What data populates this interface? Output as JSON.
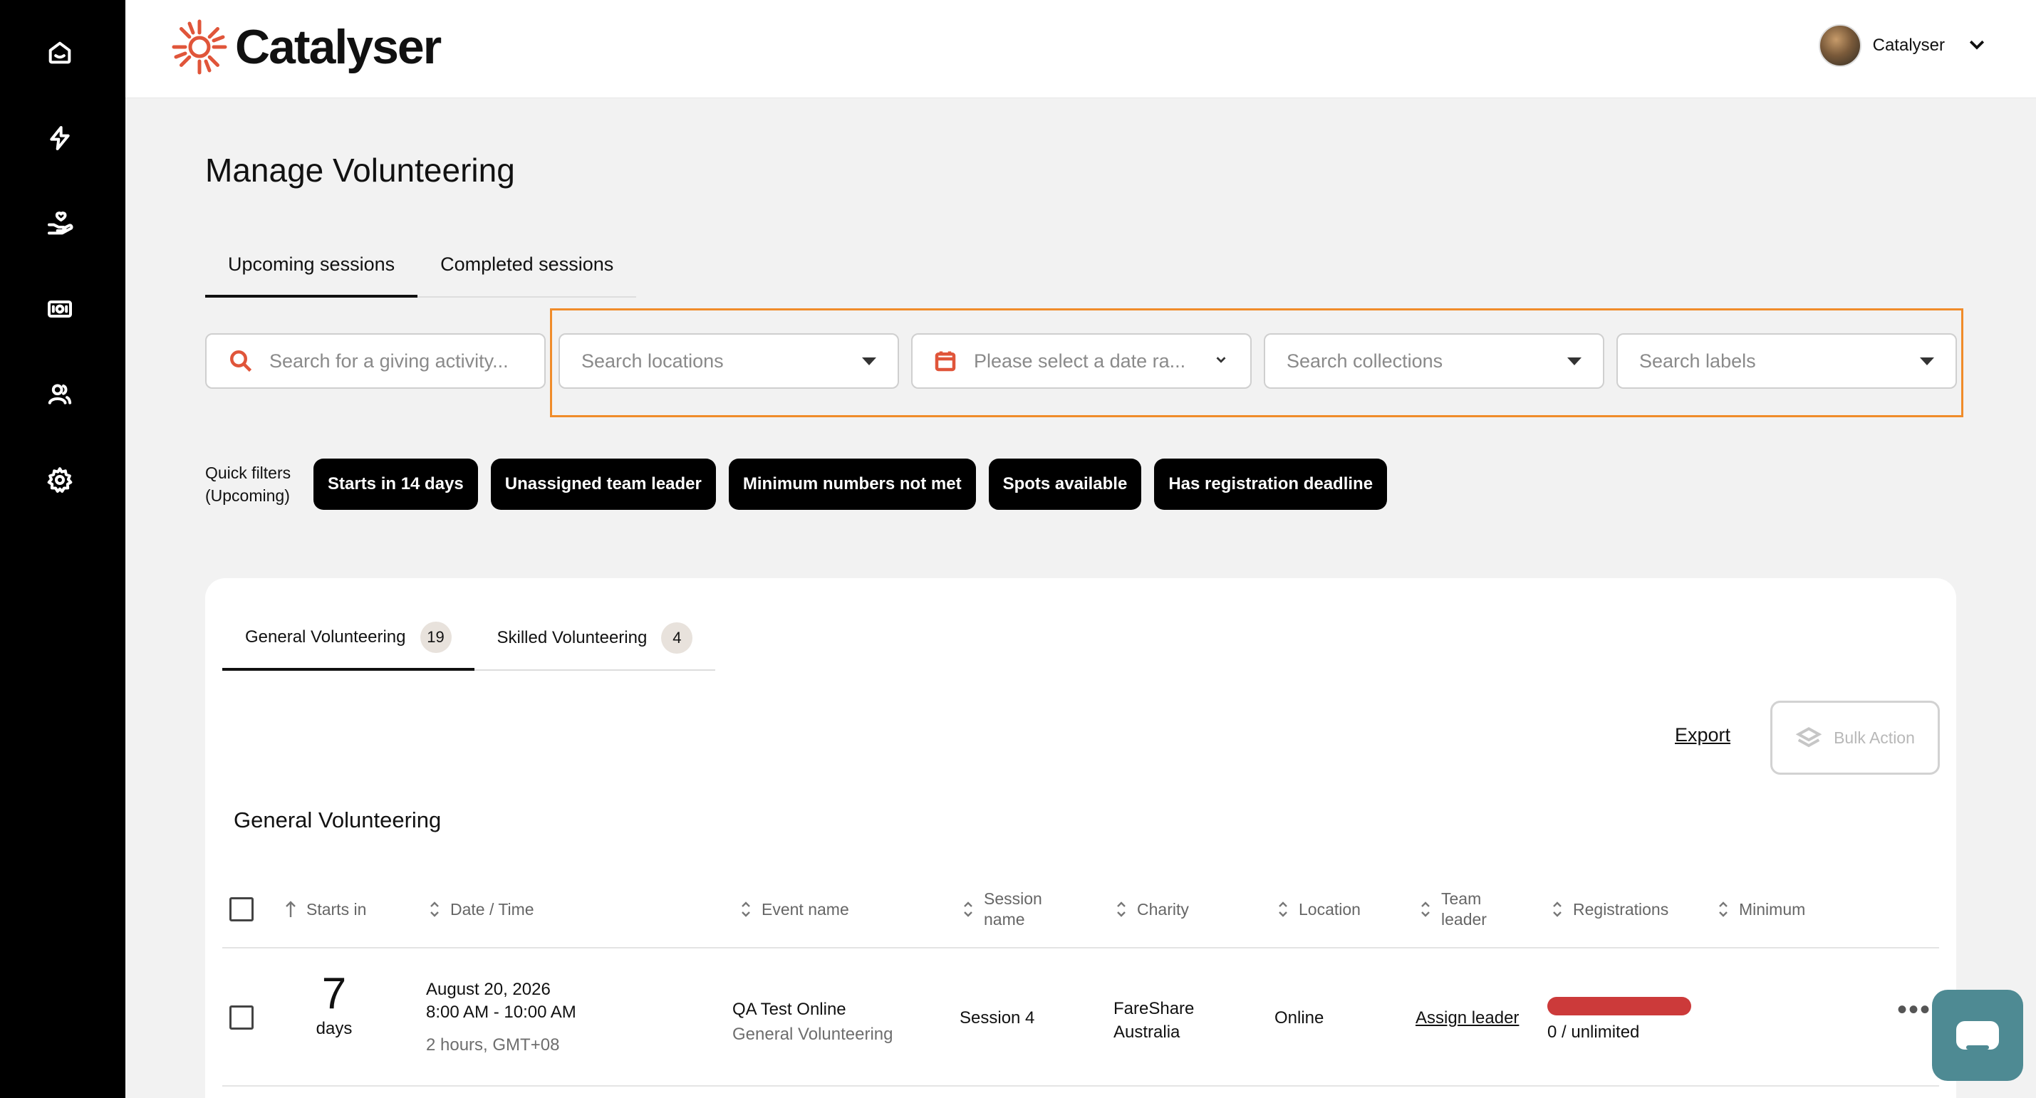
{
  "brand": {
    "name": "Catalyser",
    "accent": "#e0553a"
  },
  "sidebar": {
    "items": [
      {
        "icon": "home-icon"
      },
      {
        "icon": "lightning-icon"
      },
      {
        "icon": "hand-heart-icon"
      },
      {
        "icon": "cash-icon"
      },
      {
        "icon": "users-icon"
      },
      {
        "icon": "gear-icon"
      }
    ]
  },
  "header": {
    "user_name": "Catalyser"
  },
  "page": {
    "title": "Manage Volunteering"
  },
  "tabs": [
    {
      "label": "Upcoming sessions",
      "active": true
    },
    {
      "label": "Completed sessions",
      "active": false
    }
  ],
  "filters": {
    "search_activity": "Search for a giving activity...",
    "locations": "Search locations",
    "date_range": "Please select a date ra...",
    "collections": "Search collections",
    "labels": "Search labels"
  },
  "quick_filters": {
    "label_line1": "Quick filters",
    "label_line2": "(Upcoming)",
    "chips": [
      "Starts in 14 days",
      "Unassigned team leader",
      "Minimum numbers not met",
      "Spots available",
      "Has registration deadline"
    ]
  },
  "card": {
    "tabs": [
      {
        "label": "General Volunteering",
        "count": "19"
      },
      {
        "label": "Skilled Volunteering",
        "count": "4"
      }
    ],
    "export_label": "Export",
    "bulk_action_label": "Bulk Action",
    "section_title": "General Volunteering"
  },
  "table": {
    "headers": {
      "starts_in": "Starts in",
      "date_time": "Date / Time",
      "event_name": "Event name",
      "session_name_1": "Session",
      "session_name_2": "name",
      "charity": "Charity",
      "location": "Location",
      "team_leader_1": "Team",
      "team_leader_2": "leader",
      "registrations": "Registrations",
      "minimum": "Minimum"
    },
    "rows": [
      {
        "starts_in_number": "7",
        "starts_in_unit": "days",
        "date": "August 20, 2026",
        "time": "8:00 AM - 10:00 AM",
        "duration": "2 hours, GMT+08",
        "event_name": "QA Test Online",
        "event_type": "General Volunteering",
        "session_name": "Session 4",
        "charity_line1": "FareShare",
        "charity_line2": "Australia",
        "location": "Online",
        "team_leader": "Assign leader",
        "registrations": "0 / unlimited",
        "registration_bar_color": "#cc3a3a"
      }
    ]
  }
}
